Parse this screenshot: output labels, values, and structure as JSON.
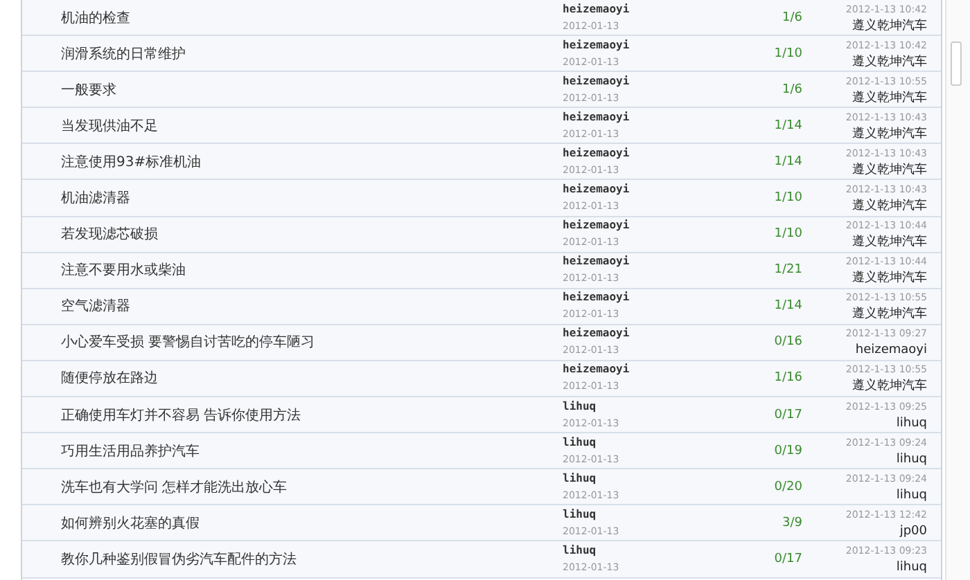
{
  "rows": [
    {
      "title": "机油的检查",
      "author": "heizemaoyi",
      "date": "2012-01-13",
      "replies": "1/6",
      "last_time": "2012-1-13 10:42",
      "last_user": "遵义乾坤汽车"
    },
    {
      "title": "润滑系统的日常维护",
      "author": "heizemaoyi",
      "date": "2012-01-13",
      "replies": "1/10",
      "last_time": "2012-1-13 10:42",
      "last_user": "遵义乾坤汽车"
    },
    {
      "title": "一般要求",
      "author": "heizemaoyi",
      "date": "2012-01-13",
      "replies": "1/6",
      "last_time": "2012-1-13 10:55",
      "last_user": "遵义乾坤汽车"
    },
    {
      "title": "当发现供油不足",
      "author": "heizemaoyi",
      "date": "2012-01-13",
      "replies": "1/14",
      "last_time": "2012-1-13 10:43",
      "last_user": "遵义乾坤汽车"
    },
    {
      "title": "注意使用93#标准机油",
      "author": "heizemaoyi",
      "date": "2012-01-13",
      "replies": "1/14",
      "last_time": "2012-1-13 10:43",
      "last_user": "遵义乾坤汽车"
    },
    {
      "title": "机油滤清器",
      "author": "heizemaoyi",
      "date": "2012-01-13",
      "replies": "1/10",
      "last_time": "2012-1-13 10:43",
      "last_user": "遵义乾坤汽车"
    },
    {
      "title": "若发现滤芯破损",
      "author": "heizemaoyi",
      "date": "2012-01-13",
      "replies": "1/10",
      "last_time": "2012-1-13 10:44",
      "last_user": "遵义乾坤汽车"
    },
    {
      "title": "注意不要用水或柴油",
      "author": "heizemaoyi",
      "date": "2012-01-13",
      "replies": "1/21",
      "last_time": "2012-1-13 10:44",
      "last_user": "遵义乾坤汽车"
    },
    {
      "title": "空气滤清器",
      "author": "heizemaoyi",
      "date": "2012-01-13",
      "replies": "1/14",
      "last_time": "2012-1-13 10:55",
      "last_user": "遵义乾坤汽车"
    },
    {
      "title": "小心爱车受损 要警惕自讨苦吃的停车陋习",
      "author": "heizemaoyi",
      "date": "2012-01-13",
      "replies": "0/16",
      "last_time": "2012-1-13 09:27",
      "last_user": "heizemaoyi"
    },
    {
      "title": "随便停放在路边",
      "author": "heizemaoyi",
      "date": "2012-01-13",
      "replies": "1/16",
      "last_time": "2012-1-13 10:55",
      "last_user": "遵义乾坤汽车"
    },
    {
      "title": "正确使用车灯并不容易 告诉你使用方法",
      "author": "lihuq",
      "date": "2012-01-13",
      "replies": "0/17",
      "last_time": "2012-1-13 09:25",
      "last_user": "lihuq"
    },
    {
      "title": "巧用生活用品养护汽车",
      "author": "lihuq",
      "date": "2012-01-13",
      "replies": "0/19",
      "last_time": "2012-1-13 09:24",
      "last_user": "lihuq"
    },
    {
      "title": "洗车也有大学问 怎样才能洗出放心车",
      "author": "lihuq",
      "date": "2012-01-13",
      "replies": "0/20",
      "last_time": "2012-1-13 09:24",
      "last_user": "lihuq"
    },
    {
      "title": "如何辨别火花塞的真假",
      "author": "lihuq",
      "date": "2012-01-13",
      "replies": "3/9",
      "last_time": "2012-1-13 12:42",
      "last_user": "jp00"
    },
    {
      "title": "教你几种鉴别假冒伪劣汽车配件的方法",
      "author": "lihuq",
      "date": "2012-01-13",
      "replies": "0/17",
      "last_time": "2012-1-13 09:23",
      "last_user": "lihuq"
    }
  ]
}
